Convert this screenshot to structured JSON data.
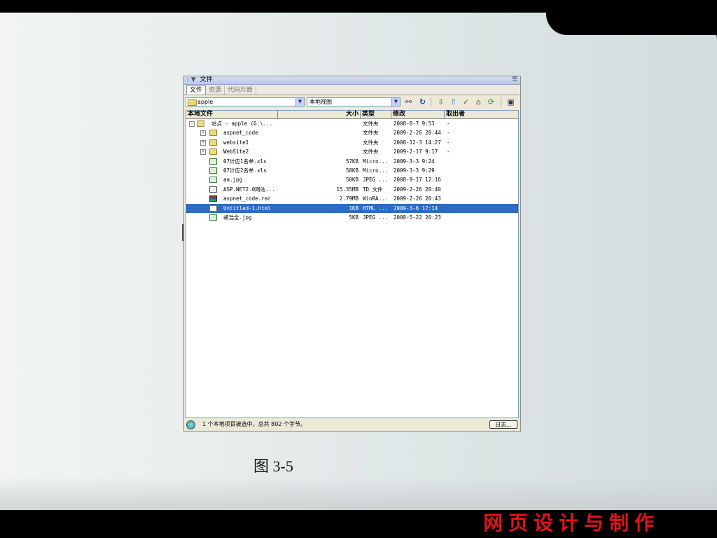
{
  "panel": {
    "title": "文件",
    "tabs": [
      "文件",
      "资源",
      "代码片断"
    ],
    "site_combo": "apple",
    "view_combo": "本地视图",
    "columns": [
      "本地文件",
      "大小",
      "类型",
      "修改",
      "取出者"
    ],
    "rows": [
      {
        "name": "站点 - apple (G:\\...",
        "size": "",
        "type": "文件夹",
        "modified": "2008-8-7 9:53",
        "checked_out": "-",
        "icon": "folder-icon",
        "indent": 0,
        "expander": "-"
      },
      {
        "name": "aspnet_code",
        "size": "",
        "type": "文件夹",
        "modified": "2009-2-26 20:44",
        "checked_out": "-",
        "icon": "folder-icon",
        "indent": 1,
        "expander": "+"
      },
      {
        "name": "website1",
        "size": "",
        "type": "文件夹",
        "modified": "2008-12-3 14:27",
        "checked_out": "-",
        "icon": "folder-icon",
        "indent": 1,
        "expander": "+"
      },
      {
        "name": "WebSite2",
        "size": "",
        "type": "文件夹",
        "modified": "2009-2-17 9:17",
        "checked_out": "-",
        "icon": "folder-icon",
        "indent": 1,
        "expander": "+"
      },
      {
        "name": "07计应1名单.xls",
        "size": "57KB",
        "type": "Micro...",
        "modified": "2009-3-3 9:24",
        "checked_out": "",
        "icon": "xls-file-icon",
        "indent": 1,
        "expander": ""
      },
      {
        "name": "07计应2名单.xls",
        "size": "58KB",
        "type": "Micro...",
        "modified": "2009-3-3 9:29",
        "checked_out": "",
        "icon": "xls-file-icon",
        "indent": 1,
        "expander": ""
      },
      {
        "name": "aa.jpg",
        "size": "50KB",
        "type": "JPEG ...",
        "modified": "2008-9-17 12:16",
        "checked_out": "",
        "icon": "jpg-file-icon",
        "indent": 1,
        "expander": ""
      },
      {
        "name": "ASP.NET2.0网站...",
        "size": "15.35MB",
        "type": "TD 文件",
        "modified": "2009-2-26 20:40",
        "checked_out": "",
        "icon": "asp-file-icon",
        "indent": 1,
        "expander": ""
      },
      {
        "name": "aspnet_code.rar",
        "size": "2.79MB",
        "type": "WinRA...",
        "modified": "2009-2-26 20:43",
        "checked_out": "",
        "icon": "rar-file-icon",
        "indent": 1,
        "expander": ""
      },
      {
        "name": "Untitled-1.html",
        "size": "1KB",
        "type": "HTML ...",
        "modified": "2009-3-6 17:14",
        "checked_out": "",
        "icon": "html-file-icon",
        "indent": 1,
        "expander": "",
        "selected": true
      },
      {
        "name": "胡浩全.jpg",
        "size": "5KB",
        "type": "JPEG ...",
        "modified": "2008-5-22 20:23",
        "checked_out": "",
        "icon": "jpg-file-icon",
        "indent": 1,
        "expander": ""
      }
    ],
    "status_text": "1 个本地项目被选中，总共 802 个字节。",
    "log_button": "日志..."
  },
  "caption": "图  3-5",
  "footer_title": "网页设计与制作",
  "colors": {
    "selection": "#316ac5",
    "footer_title": "#e0141a"
  }
}
